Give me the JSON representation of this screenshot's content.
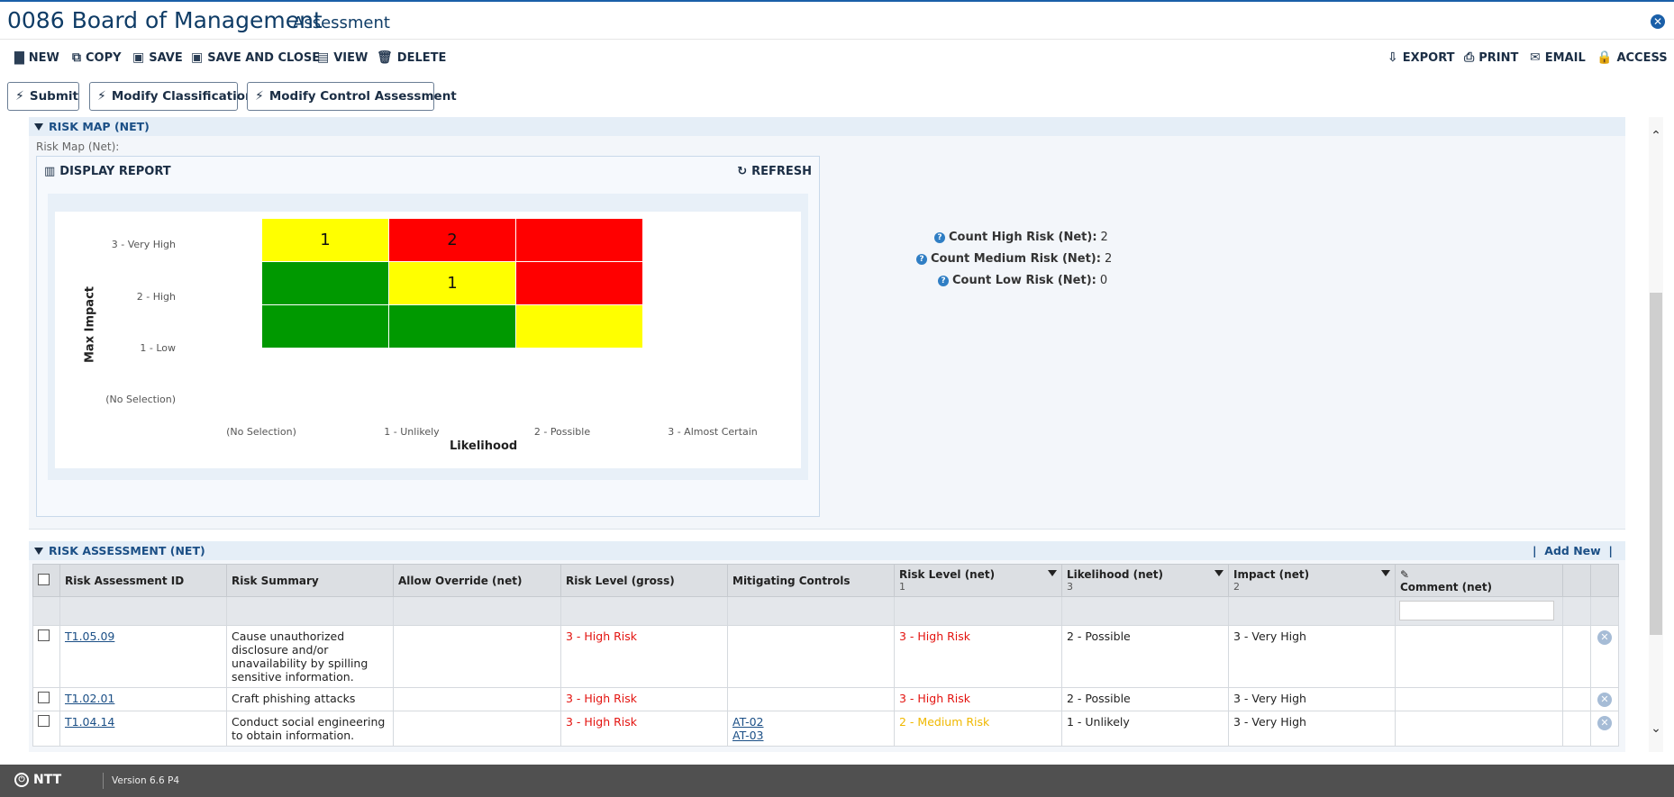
{
  "window": {
    "title": "0086 Board of Management",
    "subtitle": "Assessment",
    "close_icon": "close-icon"
  },
  "toolbar": {
    "new": "NEW",
    "copy": "COPY",
    "save": "SAVE",
    "save_close": "SAVE AND CLOSE",
    "view": "VIEW",
    "delete": "DELETE",
    "export": "EXPORT",
    "print": "PRINT",
    "email": "EMAIL",
    "access": "ACCESS"
  },
  "actions": {
    "submit": "Submit",
    "modify_classification": "Modify Classification",
    "modify_control": "Modify Control Assessment"
  },
  "risk_map": {
    "section_title": "RISK MAP (NET)",
    "field_label": "Risk Map (Net):",
    "display_report": "DISPLAY REPORT",
    "refresh": "REFRESH",
    "y_axis_title": "Max Impact",
    "x_axis_title": "Likelihood",
    "y_labels": [
      "3 - Very High",
      "2 - High",
      "1 - Low",
      "(No Selection)"
    ],
    "x_labels": [
      "(No Selection)",
      "1 - Unlikely",
      "2 - Possible",
      "3 - Almost Certain"
    ],
    "colors": {
      "high": "#ff0000",
      "medium": "#ffff00",
      "low": "#009900"
    },
    "cells": [
      {
        "row": "3 - Very High",
        "col": "1 - Unlikely",
        "level": "medium",
        "count": "1"
      },
      {
        "row": "3 - Very High",
        "col": "2 - Possible",
        "level": "high",
        "count": "2"
      },
      {
        "row": "3 - Very High",
        "col": "3 - Almost Certain",
        "level": "high",
        "count": ""
      },
      {
        "row": "2 - High",
        "col": "1 - Unlikely",
        "level": "low",
        "count": ""
      },
      {
        "row": "2 - High",
        "col": "2 - Possible",
        "level": "medium",
        "count": "1"
      },
      {
        "row": "2 - High",
        "col": "3 - Almost Certain",
        "level": "high",
        "count": ""
      },
      {
        "row": "1 - Low",
        "col": "1 - Unlikely",
        "level": "low",
        "count": ""
      },
      {
        "row": "1 - Low",
        "col": "2 - Possible",
        "level": "low",
        "count": ""
      },
      {
        "row": "1 - Low",
        "col": "3 - Almost Certain",
        "level": "medium",
        "count": ""
      }
    ],
    "counts": [
      {
        "label": "Count High Risk (Net):",
        "value": "2"
      },
      {
        "label": "Count Medium Risk (Net):",
        "value": "2"
      },
      {
        "label": "Count Low Risk (Net):",
        "value": "0"
      }
    ]
  },
  "risk_assessment": {
    "section_title": "RISK ASSESSMENT (NET)",
    "add_new": "Add New",
    "columns": [
      {
        "label": "Risk Assessment ID",
        "count": ""
      },
      {
        "label": "Risk Summary",
        "count": ""
      },
      {
        "label": "Allow Override (net)",
        "count": ""
      },
      {
        "label": "Risk Level (gross)",
        "count": ""
      },
      {
        "label": "Mitigating Controls",
        "count": ""
      },
      {
        "label": "Risk Level (net)",
        "count": "1"
      },
      {
        "label": "Likelihood (net)",
        "count": "3"
      },
      {
        "label": "Impact (net)",
        "count": "2"
      },
      {
        "label": "Comment (net)",
        "count": ""
      }
    ],
    "rows": [
      {
        "id": "T1.05.09",
        "summary": "Cause unauthorized disclosure and/or unavailability by spilling sensitive information.",
        "override": "",
        "gross": "3 - High Risk",
        "controls": [],
        "net": "3 - High Risk",
        "net_level": "high",
        "likelihood": "2 - Possible",
        "impact": "3 - Very High",
        "comment": ""
      },
      {
        "id": "T1.02.01",
        "summary": "Craft phishing attacks",
        "override": "",
        "gross": "3 - High Risk",
        "controls": [],
        "net": "3 - High Risk",
        "net_level": "high",
        "likelihood": "2 - Possible",
        "impact": "3 - Very High",
        "comment": ""
      },
      {
        "id": "T1.04.14",
        "summary": "Conduct social engineering to obtain information.",
        "override": "",
        "gross": "3 - High Risk",
        "controls": [
          "AT-02",
          "AT-03"
        ],
        "net": "2 - Medium Risk",
        "net_level": "medium",
        "likelihood": "1 - Unlikely",
        "impact": "3 - Very High",
        "comment": ""
      }
    ]
  },
  "footer": {
    "brand": "NTT",
    "version": "Version 6.6 P4"
  }
}
